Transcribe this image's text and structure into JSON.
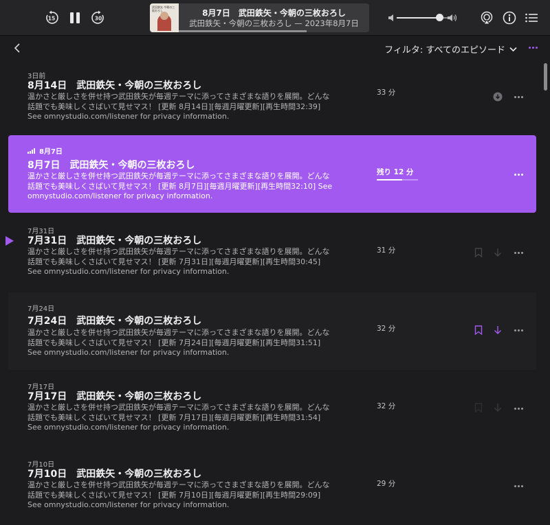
{
  "toolbar": {
    "skip_back_label": "15",
    "skip_forward_label": "30",
    "now_playing": {
      "title": "8月7日　武田鉄矢・今朝の三枚おろし",
      "subtitle": "武田鉄矢・今朝の三枚おろし — 2023年8月7日",
      "artwork_text": "武田鉄矢 今朝の三枚おろし",
      "progress": 0.67
    },
    "volume_level": 0.82
  },
  "header": {
    "filter_label": "フィルタ: すべてのエピソード"
  },
  "colors": {
    "accent": "#a259f0",
    "background": "#1c1c1e"
  },
  "episodes": [
    {
      "date": "3日前",
      "title": "8月14日　武田鉄矢・今朝の三枚おろし",
      "desc": "温かさと厳しさを併せ持つ武田鉄矢が毎週テーマに添ってさまざまな語りを展開。どんな話題でも美味しくさばいて見せマス！ [更新 8月14日][毎週月曜更新][再生時間32:39] See omnystudio.com/listener for privacy information.",
      "duration": "33 分"
    },
    {
      "date": "8月7日",
      "title": "8月7日　武田鉄矢・今朝の三枚おろし",
      "desc": "温かさと厳しさを併せ持つ武田鉄矢が毎週テーマに添ってさまざまな語りを展開。どんな話題でも美味しくさばいて見せマス！ [更新 8月7日][毎週月曜更新][再生時間32:10] See omnystudio.com/listener for privacy information.",
      "duration": "残り 12 分",
      "progress": 0.62
    },
    {
      "date": "7月31日",
      "title": "7月31日　武田鉄矢・今朝の三枚おろし",
      "desc": "温かさと厳しさを併せ持つ武田鉄矢が毎週テーマに添ってさまざまな語りを展開。どんな話題でも美味しくさばいて見せマス！ [更新 7月31日][毎週月曜更新][再生時間30:45] See omnystudio.com/listener for privacy information.",
      "duration": "31 分"
    },
    {
      "date": "7月24日",
      "title": "7月24日　武田鉄矢・今朝の三枚おろし",
      "desc": "温かさと厳しさを併せ持つ武田鉄矢が毎週テーマに添ってさまざまな語りを展開。どんな話題でも美味しくさばいて見せマス！ [更新 7月24日][毎週月曜更新][再生時間31:51] See omnystudio.com/listener for privacy information.",
      "duration": "32 分"
    },
    {
      "date": "7月17日",
      "title": "7月17日　武田鉄矢・今朝の三枚おろし",
      "desc": "温かさと厳しさを併せ持つ武田鉄矢が毎週テーマに添ってさまざまな語りを展開。どんな話題でも美味しくさばいて見せマス！ [更新 7月17日][毎週月曜更新][再生時間31:54] See omnystudio.com/listener for privacy information.",
      "duration": "32 分"
    },
    {
      "date": "7月10日",
      "title": "7月10日　武田鉄矢・今朝の三枚おろし",
      "desc": "温かさと厳しさを併せ持つ武田鉄矢が毎週テーマに添ってさまざまな語りを展開。どんな話題でも美味しくさばいて見せマス！ [更新 7月10日][毎週月曜更新][再生時間29:09] See omnystudio.com/listener for privacy information.",
      "duration": "29 分"
    }
  ]
}
